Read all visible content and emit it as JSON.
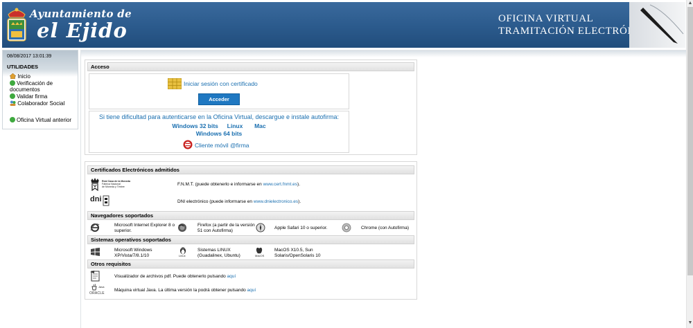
{
  "header": {
    "town_line1": "Ayuntamiento de",
    "town_line2": "el Ejido",
    "office_line1": "OFICINA VIRTUAL",
    "office_line2": "TRAMITACIÓN ELECTRÓNICA"
  },
  "sidebar": {
    "datetime": "08/08/2017 13:01:39",
    "title": "UTILIDADES",
    "items": [
      {
        "label": "Inicio",
        "icon": "home-icon"
      },
      {
        "label": "Verificación de documentos",
        "icon": "check-icon"
      },
      {
        "label": "Validar firma",
        "icon": "check-icon"
      },
      {
        "label": "Colaborador Social",
        "icon": "users-icon"
      },
      {
        "label": "Oficina Virtual anterior",
        "icon": "globe-icon"
      }
    ]
  },
  "access": {
    "title": "Acceso",
    "login_link": "Iniciar sesión con certificado",
    "login_button": "Acceder",
    "help_text": "Si tiene dificultad para autenticarse en la Oficina Virtual, descargue e instale autofirma:",
    "downloads": [
      "Windows 32 bits",
      "Linux",
      "Mac",
      "Windows 64 bits"
    ],
    "mobile_client": "Cliente móvil @firma"
  },
  "certificates": {
    "title": "Certificados Electrónicos admitidos",
    "fnmt_logo_text": [
      "Real Casa de la Moneda",
      "Fábrica Nacional",
      "de Moneda y Timbre"
    ],
    "fnmt_text": "F.N.M.T. (puede obtenerlo e informarse en ",
    "fnmt_link": "www.cert.fnmt.es",
    "fnmt_suffix": ").",
    "dni_logo_text": "dni",
    "dni_text": "DNI electrónico (puede informarse en ",
    "dni_link": "www.dnielectronico.es",
    "dni_suffix": ")."
  },
  "browsers": {
    "title": "Navegadores soportados",
    "items": [
      "Microsoft Internet Explorer 8 o superior.",
      "Firefox (a partir de la versión 51 con Autofirma)",
      "Apple Safari 10 o superior.",
      "Chrome (con Autofirma)"
    ]
  },
  "os": {
    "title": "Sistemas operativos soportados",
    "items": [
      "Microsoft Windows XP/Vista/7/8.1/10",
      "Sistemas LINUX (Guadalinex, Ubuntu)",
      "MacOS X10.5, Sun Solaris/OpenSolaris 10"
    ],
    "linux_logo_text": "Linux",
    "mac_logo_text": "MacOS"
  },
  "other": {
    "title": "Otros requisitos",
    "pdf_text": "Visualizador de archivos pdf. Puede obtenerlo pulsando ",
    "pdf_link": "aquí",
    "java_text": "Máquina virtual Java. La última versión la podrá obtener pulsando ",
    "java_link": "aquí",
    "java_logo_text": "Java",
    "oracle_logo_text": "ORACLE"
  },
  "colors": {
    "header_blue": "#2c5b8e",
    "link_blue": "#1a6fb0",
    "button_blue": "#1f78c1"
  }
}
